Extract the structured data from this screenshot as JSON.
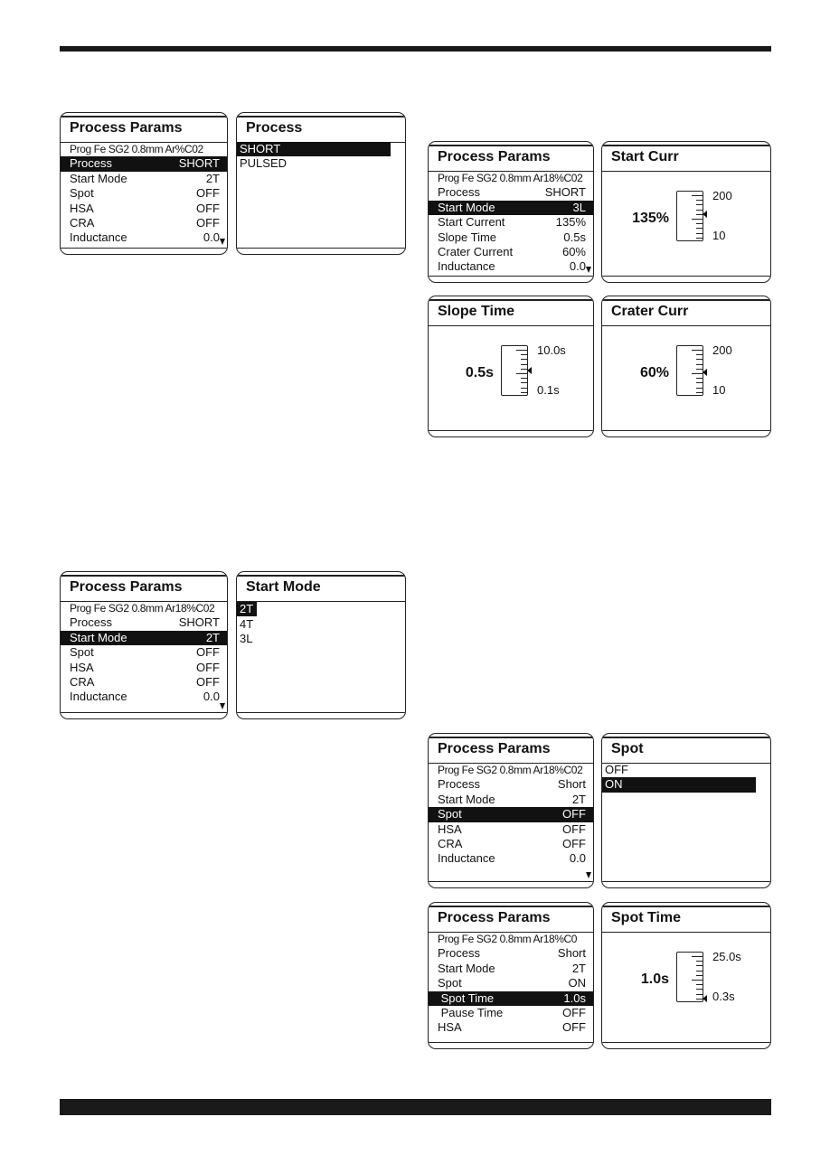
{
  "panels": [
    {
      "type": "params",
      "title": "Process Params",
      "subtitle": "Prog Fe SG2 0.8mm Ar%C02",
      "rows": [
        [
          "Process",
          "SHORT"
        ],
        [
          "Start Mode",
          "2T"
        ],
        [
          "Spot",
          "OFF"
        ],
        [
          "HSA",
          "OFF"
        ],
        [
          "CRA",
          "OFF"
        ],
        [
          "Inductance",
          "0.0"
        ]
      ],
      "selected": 0,
      "more": true
    },
    {
      "type": "list",
      "title": "Process",
      "items": [
        "SHORT",
        "PULSED"
      ],
      "selected": 0
    },
    {
      "type": "params",
      "title": "Process Params",
      "subtitle": "Prog Fe SG2 0.8mm Ar18%C02",
      "rows": [
        [
          "Process",
          "SHORT"
        ],
        [
          "Start Mode",
          "3L"
        ],
        [
          "Start Current",
          "135%"
        ],
        [
          "Slope Time",
          "0.5s"
        ],
        [
          "Crater Current",
          "60%"
        ],
        [
          "Inductance",
          "0.0"
        ]
      ],
      "selected": 1,
      "more": true
    },
    {
      "type": "gauge",
      "title": "Start Curr",
      "value": "135%",
      "max": "200",
      "min": "10",
      "pointer_level": 0.55
    },
    {
      "type": "gauge",
      "title": "Slope Time",
      "value": "0.5s",
      "max": "10.0s",
      "min": "0.1s",
      "pointer_level": 0.5
    },
    {
      "type": "gauge",
      "title": "Crater Curr",
      "value": "60%",
      "max": "200",
      "min": "10",
      "pointer_level": 0.45
    },
    {
      "type": "params",
      "title": "Process Params",
      "subtitle": "Prog Fe SG2 0.8mm Ar18%C02",
      "rows": [
        [
          "Process",
          "SHORT"
        ],
        [
          "Start Mode",
          "2T"
        ],
        [
          "Spot",
          "OFF"
        ],
        [
          "HSA",
          "OFF"
        ],
        [
          "CRA",
          "OFF"
        ],
        [
          "Inductance",
          "0.0"
        ]
      ],
      "selected": 1,
      "more": true
    },
    {
      "type": "list",
      "title": "Start Mode",
      "items": [
        "2T",
        "4T",
        "3L"
      ],
      "selected": 0,
      "short_highlight": true
    },
    {
      "type": "params",
      "title": "Process Params",
      "subtitle": "Prog Fe SG2 0.8mm Ar18%C02",
      "rows": [
        [
          "Process",
          "Short"
        ],
        [
          "Start Mode",
          "2T"
        ],
        [
          "Spot",
          "OFF"
        ],
        [
          "HSA",
          "OFF"
        ],
        [
          "CRA",
          "OFF"
        ],
        [
          "Inductance",
          "0.0"
        ]
      ],
      "selected": 2,
      "more": true
    },
    {
      "type": "list",
      "title": "Spot",
      "items": [
        "OFF",
        "ON"
      ],
      "selected": 1
    },
    {
      "type": "params",
      "title": "Process Params",
      "subtitle": "Prog Fe SG2 0.8mm Ar18%C0",
      "rows": [
        [
          "Process",
          "Short"
        ],
        [
          "Start Mode",
          "2T"
        ],
        [
          "Spot",
          "ON"
        ],
        [
          " Spot Time",
          "1.0s"
        ],
        [
          " Pause Time",
          "OFF"
        ],
        [
          "HSA",
          "OFF"
        ]
      ],
      "selected": 3,
      "more": false
    },
    {
      "type": "gauge",
      "title": "Spot Time",
      "value": "1.0s",
      "max": "25.0s",
      "min": "0.3s",
      "pointer_level": 0.0
    }
  ]
}
